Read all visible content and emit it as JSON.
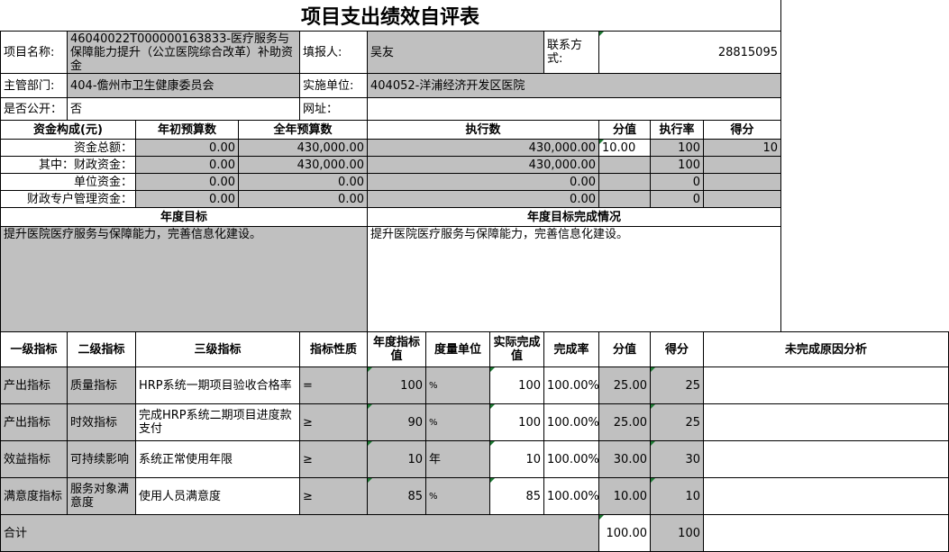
{
  "title": "项目支出绩效自评表",
  "header": {
    "project_name_label": "项目名称:",
    "project_name": "46040022T000000163833-医疗服务与保障能力提升（公立医院综合改革）补助资金",
    "reporter_label": "填报人:",
    "reporter": "吴友",
    "contact_label": "联系方式:",
    "contact": "28815095",
    "dept_label": "主管部门:",
    "dept": "404-儋州市卫生健康委员会",
    "impl_label": "实施单位:",
    "impl": "404052-洋浦经济开发区医院",
    "public_label": "是否公开：",
    "public": "否",
    "url_label": "网址："
  },
  "funds": {
    "headers": {
      "source": "资金构成(元)",
      "initial": "年初预算数",
      "annual": "全年预算数",
      "executed": "执行数",
      "score_val": "分值",
      "rate": "执行率",
      "score": "得分"
    },
    "rows": [
      {
        "label": "资金总额：",
        "initial": "0.00",
        "annual": "430,000.00",
        "executed": "430,000.00",
        "score_val": "10.00",
        "rate": "100",
        "score": "10"
      },
      {
        "label": "其中：财政资金：",
        "initial": "0.00",
        "annual": "430,000.00",
        "executed": "430,000.00",
        "score_val": "",
        "rate": "100",
        "score": ""
      },
      {
        "label": "单位资金：",
        "initial": "0.00",
        "annual": "0.00",
        "executed": "0.00",
        "score_val": "",
        "rate": "0",
        "score": ""
      },
      {
        "label": "财政专户管理资金：",
        "initial": "0.00",
        "annual": "0.00",
        "executed": "0.00",
        "score_val": "",
        "rate": "0",
        "score": ""
      }
    ]
  },
  "goals": {
    "annual_label": "年度目标",
    "completion_label": "年度目标完成情况",
    "annual_text": "提升医院医疗服务与保障能力，完善信息化建设。",
    "completion_text": "提升医院医疗服务与保障能力，完善信息化建设。"
  },
  "indicators": {
    "headers": {
      "l1": "一级指标",
      "l2": "二级指标",
      "l3": "三级指标",
      "nature": "指标性质",
      "target": "年度指标值",
      "unit": "度量单位",
      "actual": "实际完成值",
      "rate": "完成率",
      "score_val": "分值",
      "score": "得分",
      "reason": "未完成原因分析"
    },
    "rows": [
      {
        "l1": "产出指标",
        "l2": "质量指标",
        "l3": "HRP系统一期项目验收合格率",
        "nature": "=",
        "target": "100",
        "unit": "%",
        "actual": "100",
        "rate": "100.00%",
        "score_val": "25.00",
        "score": "25",
        "reason": ""
      },
      {
        "l1": "产出指标",
        "l2": "时效指标",
        "l3": "完成HRP系统二期项目进度款支付",
        "nature": "≥",
        "target": "90",
        "unit": "%",
        "actual": "100",
        "rate": "100.00%",
        "score_val": "25.00",
        "score": "25",
        "reason": ""
      },
      {
        "l1": "效益指标",
        "l2": "可持续影响",
        "l3": "系统正常使用年限",
        "nature": "≥",
        "target": "10",
        "unit": "年",
        "actual": "10",
        "rate": "100.00%",
        "score_val": "30.00",
        "score": "30",
        "reason": ""
      },
      {
        "l1": "满意度指标",
        "l2": "服务对象满意度",
        "l3": "使用人员满意度",
        "nature": "≥",
        "target": "85",
        "unit": "%",
        "actual": "85",
        "rate": "100.00%",
        "score_val": "10.00",
        "score": "10",
        "reason": ""
      }
    ]
  },
  "total": {
    "label": "合计",
    "score_val": "100.00",
    "score": "100"
  }
}
